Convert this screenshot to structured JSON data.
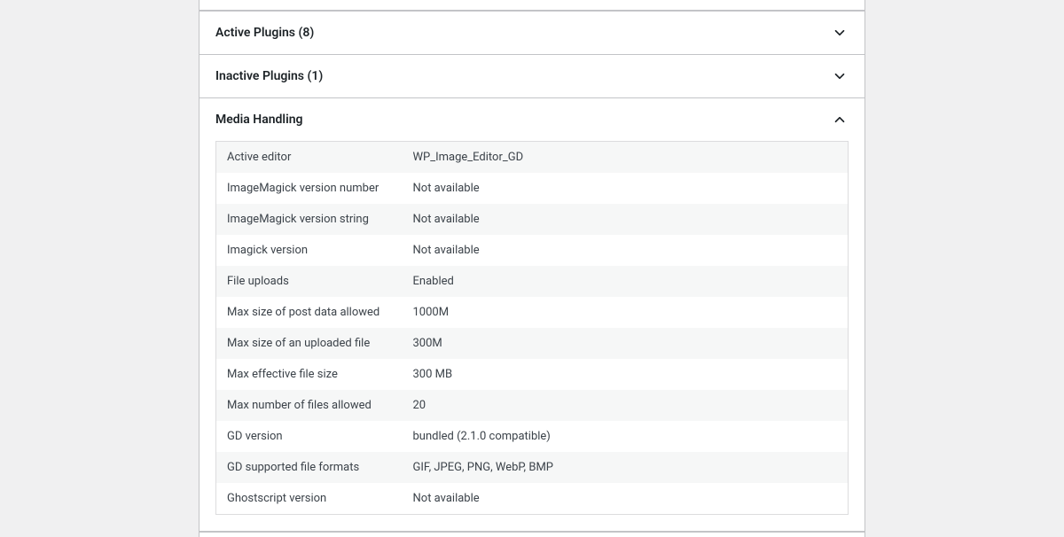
{
  "panels": {
    "activePlugins": {
      "title": "Active Plugins (8)"
    },
    "inactivePlugins": {
      "title": "Inactive Plugins (1)"
    },
    "mediaHandling": {
      "title": "Media Handling",
      "rows": [
        {
          "label": "Active editor",
          "value": "WP_Image_Editor_GD"
        },
        {
          "label": "ImageMagick version number",
          "value": "Not available"
        },
        {
          "label": "ImageMagick version string",
          "value": "Not available"
        },
        {
          "label": "Imagick version",
          "value": "Not available"
        },
        {
          "label": "File uploads",
          "value": "Enabled"
        },
        {
          "label": "Max size of post data allowed",
          "value": "1000M"
        },
        {
          "label": "Max size of an uploaded file",
          "value": "300M"
        },
        {
          "label": "Max effective file size",
          "value": "300 MB"
        },
        {
          "label": "Max number of files allowed",
          "value": "20"
        },
        {
          "label": "GD version",
          "value": "bundled (2.1.0 compatible)"
        },
        {
          "label": "GD supported file formats",
          "value": "GIF, JPEG, PNG, WebP, BMP"
        },
        {
          "label": "Ghostscript version",
          "value": "Not available"
        }
      ]
    }
  }
}
